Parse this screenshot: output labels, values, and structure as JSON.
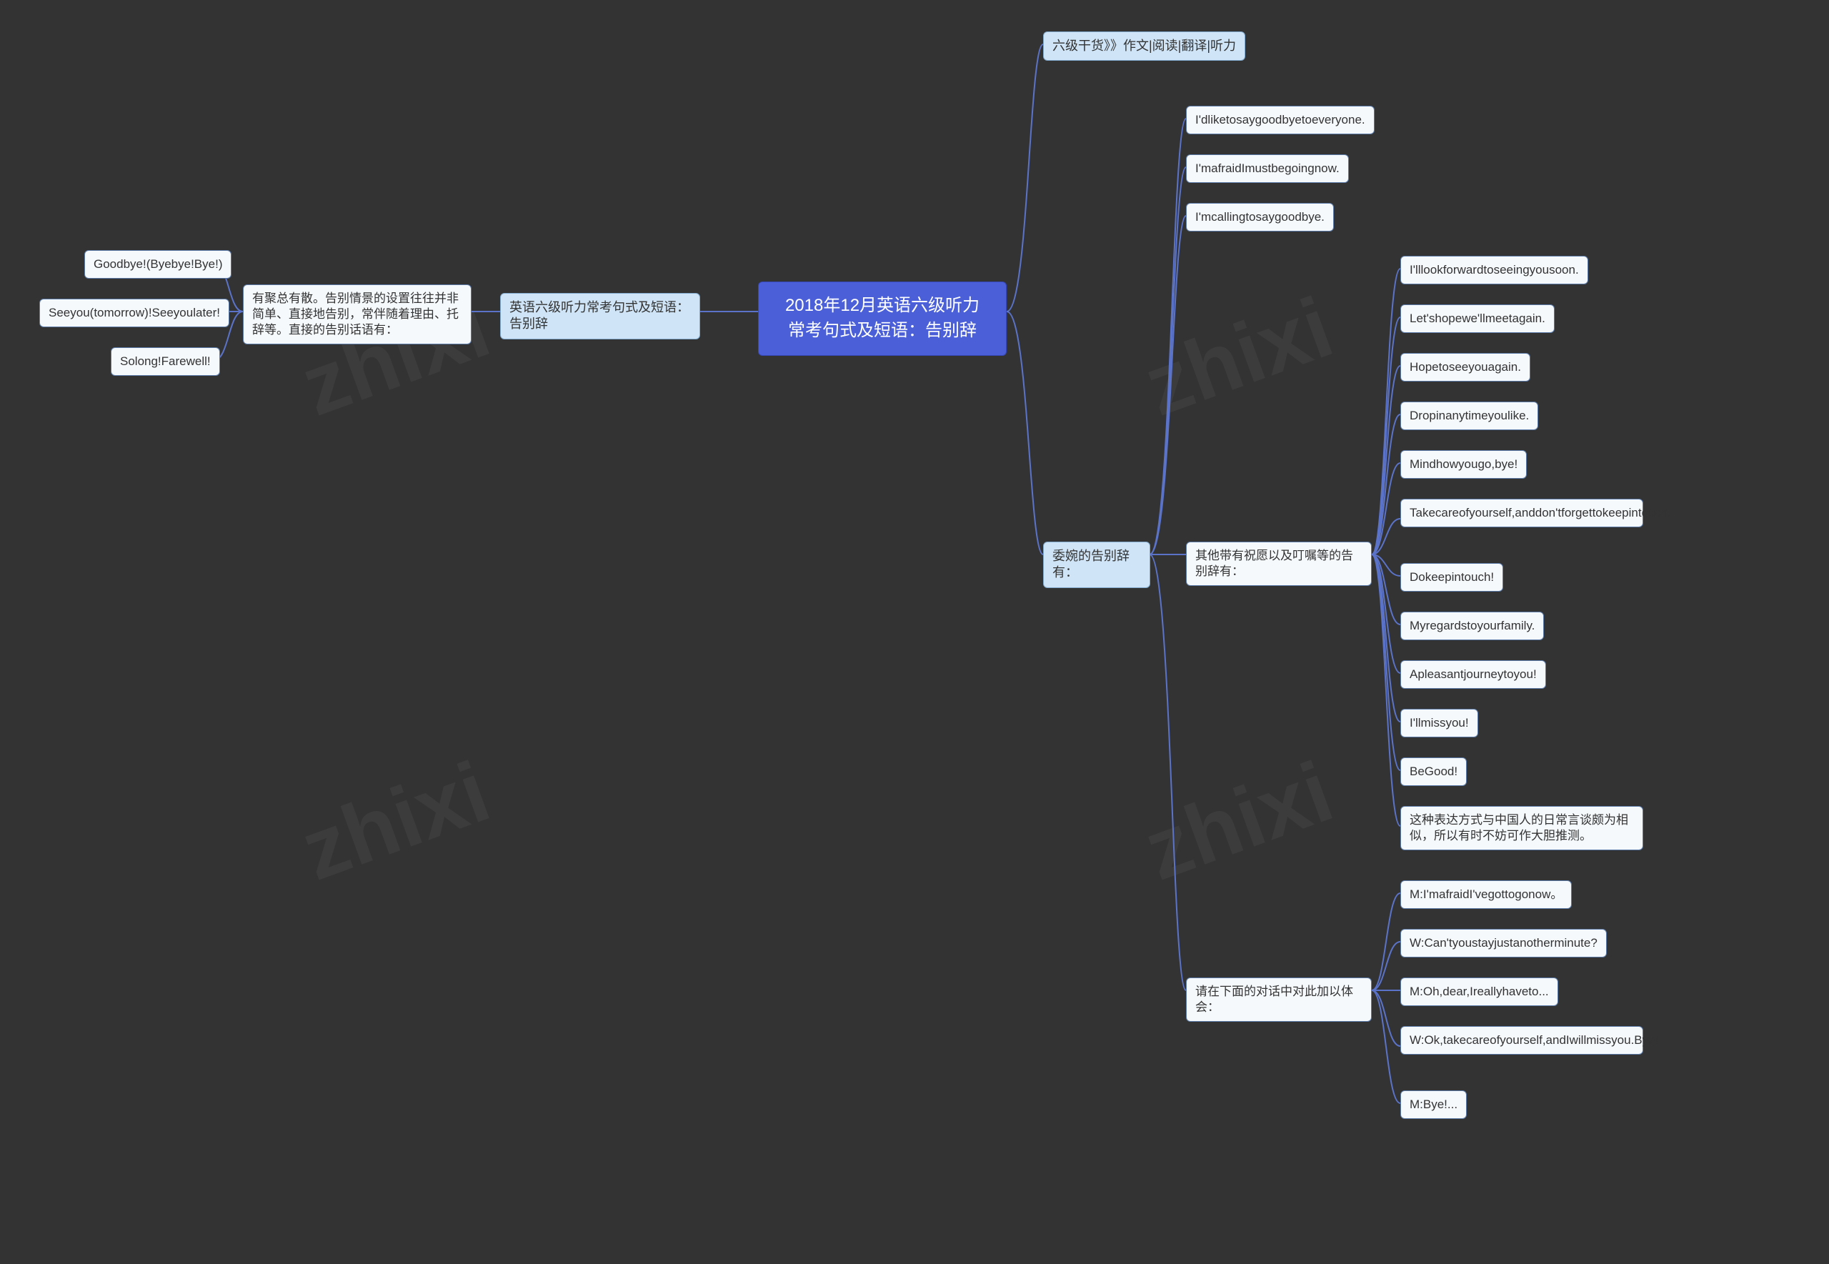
{
  "root": "2018年12月英语六级听力\n常考句式及短语：告别辞",
  "left": {
    "branch1": "英语六级听力常考句式及短语：告别辞",
    "scene_desc": "有聚总有散。告别情景的设置往往并非简单、直接地告别，常伴随着理由、托辞等。直接的告别话语有：",
    "phrases": {
      "p1": "Goodbye!(Byebye!Bye!)",
      "p2": "Seeyou(tomorrow)!Seeyoulater!",
      "p3": "Solong!Farewell!"
    }
  },
  "right": {
    "r1": "六级干货》》作文|阅读|翻译|听力",
    "r2_title": "委婉的告别辞有：",
    "r2_direct": {
      "d1": "I'dliketosaygoodbyetoeveryone.",
      "d2": "I'mafraidImustbegoingnow.",
      "d3": "I'mcallingtosaygoodbye."
    },
    "r2_other_title": "其他带有祝愿以及叮嘱等的告别辞有：",
    "r2_other": {
      "o1": "I'lllookforwardtoseeingyousoon.",
      "o2": "Let'shopewe'llmeetagain.",
      "o3": "Hopetoseeyouagain.",
      "o4": "Dropinanytimeyoulike.",
      "o5": "Mindhowyougo,bye!",
      "o6": "Takecareofyourself,anddon'tforgettokeepintouch.",
      "o7": "Dokeepintouch!",
      "o8": "Myregardstoyourfamily.",
      "o9": "Apleasantjourneytoyou!",
      "o10": "I'llmissyou!",
      "o11": "BeGood!",
      "o12": "这种表达方式与中国人的日常言谈颇为相似，所以有时不妨可作大胆推测。"
    },
    "r2_dialog_title": "请在下面的对话中对此加以体会：",
    "r2_dialog": {
      "l1": "M:I'mafraidI'vegottogonow。",
      "l2": "W:Can'tyoustayjustanotherminute?",
      "l3": "M:Oh,dear,Ireallyhaveto...",
      "l4": "W:Ok,takecareofyourself,andIwillmissyou.Bye!",
      "l5": "M:Bye!..."
    }
  },
  "chart_data": {
    "type": "mindmap",
    "root": "2018年12月英语六级听力常考句式及短语：告别辞",
    "children": [
      {
        "label": "英语六级听力常考句式及短语：告别辞",
        "side": "left",
        "children": [
          {
            "label": "有聚总有散。告别情景的设置往往并非简单、直接地告别，常伴随着理由、托辞等。直接的告别话语有：",
            "children": [
              {
                "label": "Goodbye!(Byebye!Bye!)"
              },
              {
                "label": "Seeyou(tomorrow)!Seeyoulater!"
              },
              {
                "label": "Solong!Farewell!"
              }
            ]
          }
        ]
      },
      {
        "label": "六级干货》》作文|阅读|翻译|听力",
        "side": "right"
      },
      {
        "label": "委婉的告别辞有：",
        "side": "right",
        "children": [
          {
            "label": "I'dliketosaygoodbyetoeveryone."
          },
          {
            "label": "I'mafraidImustbegoingnow."
          },
          {
            "label": "I'mcallingtosaygoodbye."
          },
          {
            "label": "其他带有祝愿以及叮嘱等的告别辞有：",
            "children": [
              {
                "label": "I'lllookforwardtoseeingyousoon."
              },
              {
                "label": "Let'shopewe'llmeetagain."
              },
              {
                "label": "Hopetoseeyouagain."
              },
              {
                "label": "Dropinanytimeyoulike."
              },
              {
                "label": "Mindhowyougo,bye!"
              },
              {
                "label": "Takecareofyourself,anddon'tforgettokeepintouch."
              },
              {
                "label": "Dokeepintouch!"
              },
              {
                "label": "Myregardstoyourfamily."
              },
              {
                "label": "Apleasantjourneytoyou!"
              },
              {
                "label": "I'llmissyou!"
              },
              {
                "label": "BeGood!"
              },
              {
                "label": "这种表达方式与中国人的日常言谈颇为相似，所以有时不妨可作大胆推测。"
              }
            ]
          },
          {
            "label": "请在下面的对话中对此加以体会：",
            "children": [
              {
                "label": "M:I'mafraidI'vegottogonow。"
              },
              {
                "label": "W:Can'tyoustayjustanotherminute?"
              },
              {
                "label": "M:Oh,dear,Ireallyhaveto..."
              },
              {
                "label": "W:Ok,takecareofyourself,andIwillmissyou.Bye!"
              },
              {
                "label": "M:Bye!..."
              }
            ]
          }
        ]
      }
    ]
  }
}
